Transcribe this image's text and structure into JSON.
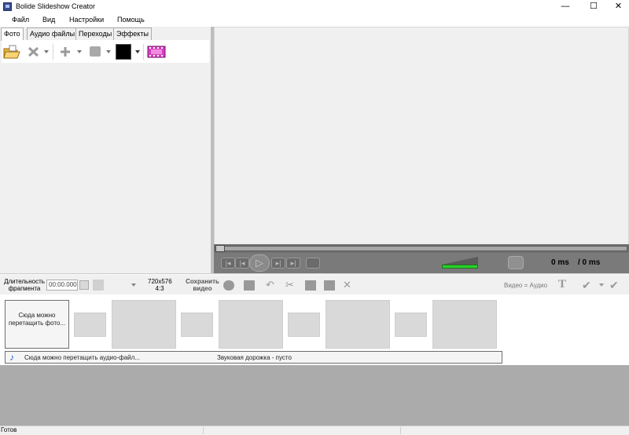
{
  "window": {
    "title": "Bolide Slideshow Creator",
    "minimize": "—",
    "maximize": "☐",
    "close": "✕"
  },
  "menu": [
    "Файл",
    "Вид",
    "Настройки",
    "Помощь"
  ],
  "tabs": [
    "Фото",
    "Аудио файлы",
    "Переходы",
    "Эффекты"
  ],
  "player": {
    "time_current": "0 ms",
    "time_total": "/ 0 ms",
    "buttons": [
      "|◂",
      "|◂",
      "▷",
      "▸|",
      "▸|"
    ]
  },
  "timeline_toolbar": {
    "duration_label": "Длительность фрагмента",
    "duration_value": "00:00.000",
    "resolution": "720x576",
    "aspect": "4:3",
    "save_video": "Сохранить видео",
    "video_audio": "Видео = Аудио",
    "text_icon": "T"
  },
  "timeline": {
    "photo_drop_hint": "Сюда можно перетащить фото...",
    "audio_drop_hint": "Сюда можно перетащить аудио-файл...",
    "audio_track_status": "Звуковая дорожка - пусто",
    "note_icon": "♪"
  },
  "status": {
    "text": "Готов"
  },
  "colors": {
    "volume": "#2bd12b",
    "player_bg": "#7a7a7a",
    "workspace": "#ababab",
    "note": "#1a6cd6"
  }
}
